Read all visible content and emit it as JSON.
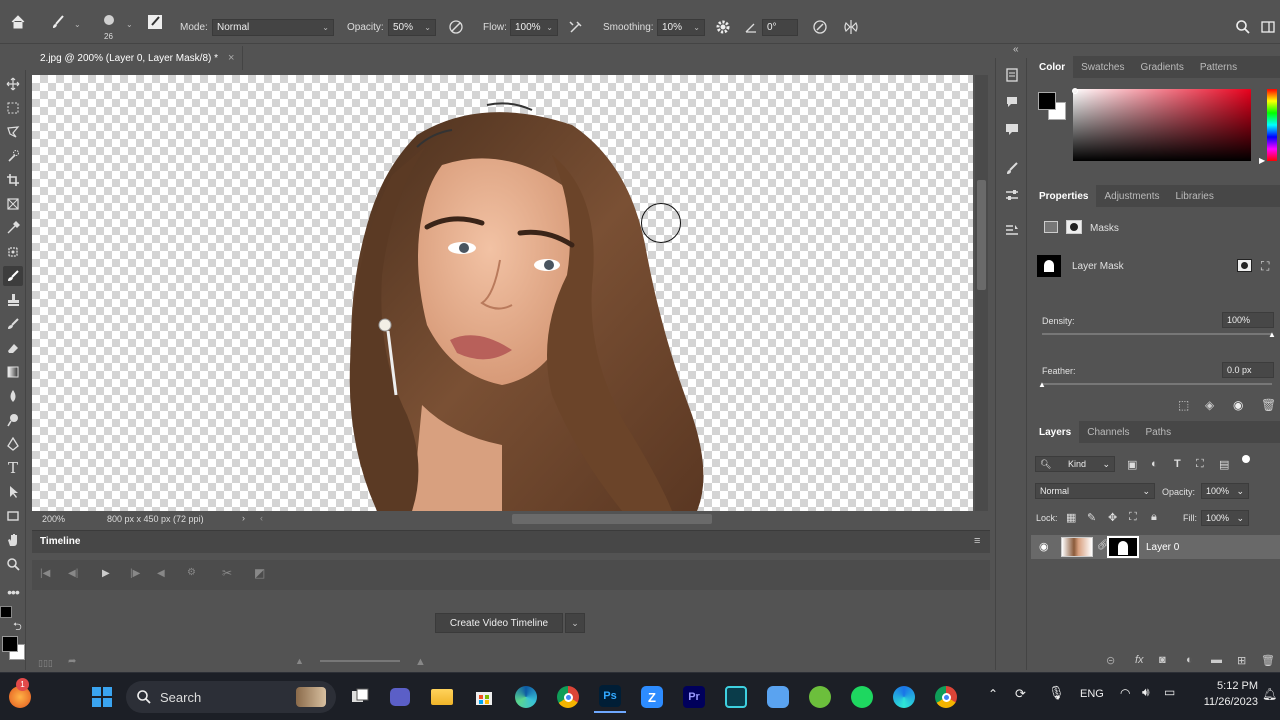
{
  "options_bar": {
    "brush_size": "26",
    "mode_label": "Mode:",
    "mode_value": "Normal",
    "opacity_label": "Opacity:",
    "opacity_value": "50%",
    "flow_label": "Flow:",
    "flow_value": "100%",
    "smoothing_label": "Smoothing:",
    "smoothing_value": "10%",
    "angle_value": "0°"
  },
  "document": {
    "tab_title": "2.jpg @ 200% (Layer 0, Layer Mask/8) *",
    "close_glyph": "×",
    "zoom": "200%",
    "dimensions": "800 px x 450 px (72 ppi)"
  },
  "timeline": {
    "title": "Timeline",
    "create_button": "Create Video Timeline"
  },
  "color_panel": {
    "tabs": [
      "Color",
      "Swatches",
      "Gradients",
      "Patterns"
    ],
    "foreground": "#000000",
    "background": "#ffffff",
    "hue": "#e8001c"
  },
  "properties_panel": {
    "tabs": [
      "Properties",
      "Adjustments",
      "Libraries"
    ],
    "masks_label": "Masks",
    "layer_mask_label": "Layer Mask",
    "density_label": "Density:",
    "density_value": "100%",
    "density_level": 1.0,
    "feather_label": "Feather:",
    "feather_value": "0.0 px",
    "feather_level": 0.0
  },
  "layers_panel": {
    "tabs": [
      "Layers",
      "Channels",
      "Paths"
    ],
    "kind_label": "Kind",
    "blend_mode": "Normal",
    "opacity_label": "Opacity:",
    "opacity_value": "100%",
    "lock_label": "Lock:",
    "fill_label": "Fill:",
    "fill_value": "100%",
    "layers": [
      {
        "name": "Layer 0"
      }
    ]
  },
  "taskbar": {
    "search_label": "Search",
    "notification_count": "1",
    "language": "ENG",
    "time": "5:12 PM",
    "date": "11/26/2023"
  }
}
